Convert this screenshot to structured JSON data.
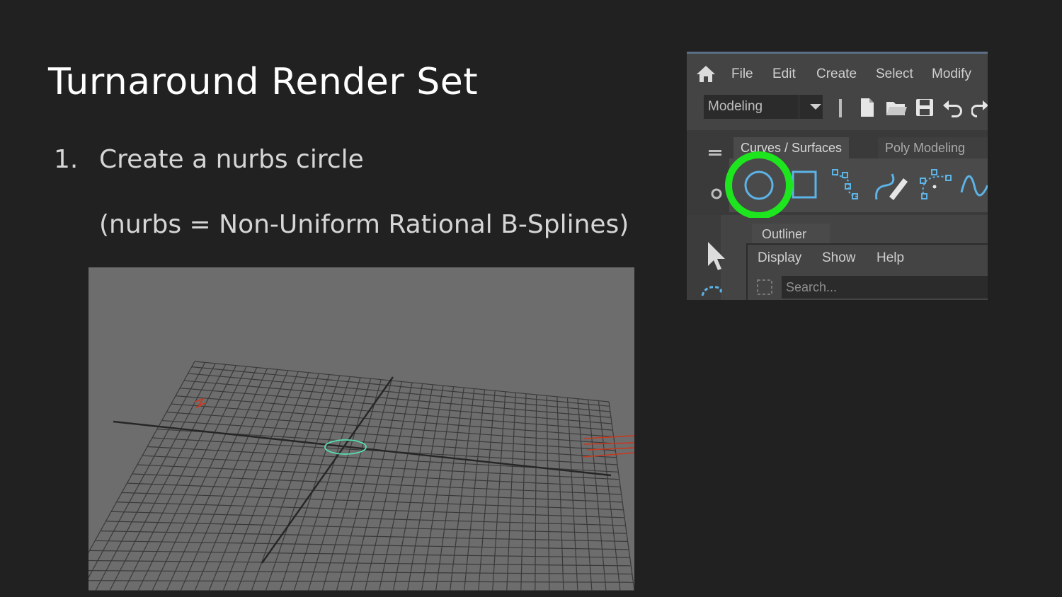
{
  "slide": {
    "title": "Turnaround Render Set",
    "step_number": "1.",
    "step_text": "Create a nurbs circle",
    "note": "(nurbs = Non-Uniform Rational B-Splines)"
  },
  "maya": {
    "menu": [
      "File",
      "Edit",
      "Create",
      "Select",
      "Modify"
    ],
    "mode_select": "Modeling",
    "shelf_tabs": [
      "Curves / Surfaces",
      "Poly Modeling"
    ],
    "outliner_tab": "Outliner",
    "outliner_menu": [
      "Display",
      "Show",
      "Help"
    ],
    "search_placeholder": "Search..."
  },
  "colors": {
    "highlight": "#1ee61e",
    "maya_icon": "#5cb3e6",
    "circle_in_viewport": "#57e0b4",
    "manipulator": "#c8391e"
  },
  "icons": [
    "home-icon",
    "new-file-icon",
    "open-folder-icon",
    "save-icon",
    "undo-icon",
    "redo-icon",
    "circle-icon",
    "square-icon",
    "cv-curve-icon",
    "pencil-curve-icon",
    "arc-icon",
    "sine-curve-icon",
    "select-arrow-icon",
    "lasso-icon",
    "gear-icon"
  ]
}
